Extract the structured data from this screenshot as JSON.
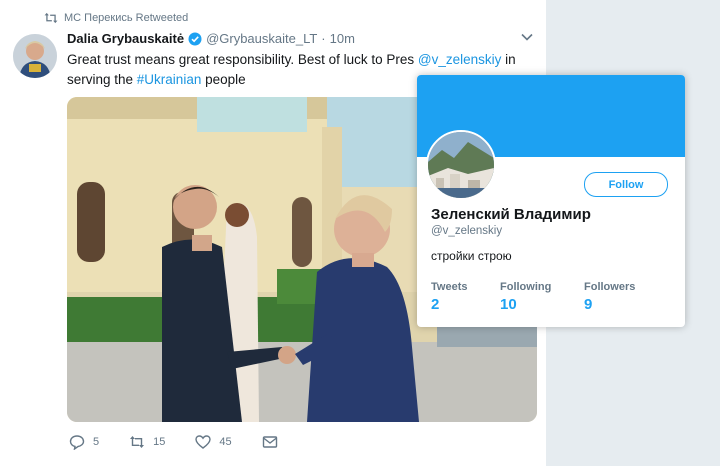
{
  "colors": {
    "accent": "#1da1f2",
    "link": "#1b95e0",
    "text": "#14171a",
    "muted": "#657786",
    "background": "#e6ecf0"
  },
  "retweet": {
    "icon": "retweet-icon",
    "text": "МС Перекись Retweeted"
  },
  "tweet": {
    "author_name": "Dalia Grybauskaitė",
    "verified_icon": "verified-badge-icon",
    "handle": "@Grybauskaite_LT",
    "separator": "·",
    "time": "10m",
    "text_before": "Great trust means great responsibility. Best of luck to Pres ",
    "mention": "@v_zelenskiy",
    "text_middle": " in serving the ",
    "hashtag": "#Ukrainian",
    "text_after": " people",
    "actions": {
      "reply_count": "5",
      "retweet_count": "15",
      "like_count": "45"
    }
  },
  "profile_card": {
    "name": "Зеленский Владимир",
    "handle": "@v_zelenskiy",
    "bio": "стройки строю",
    "follow_label": "Follow",
    "stats": [
      {
        "label": "Tweets",
        "value": "2"
      },
      {
        "label": "Following",
        "value": "10"
      },
      {
        "label": "Followers",
        "value": "9"
      }
    ]
  }
}
